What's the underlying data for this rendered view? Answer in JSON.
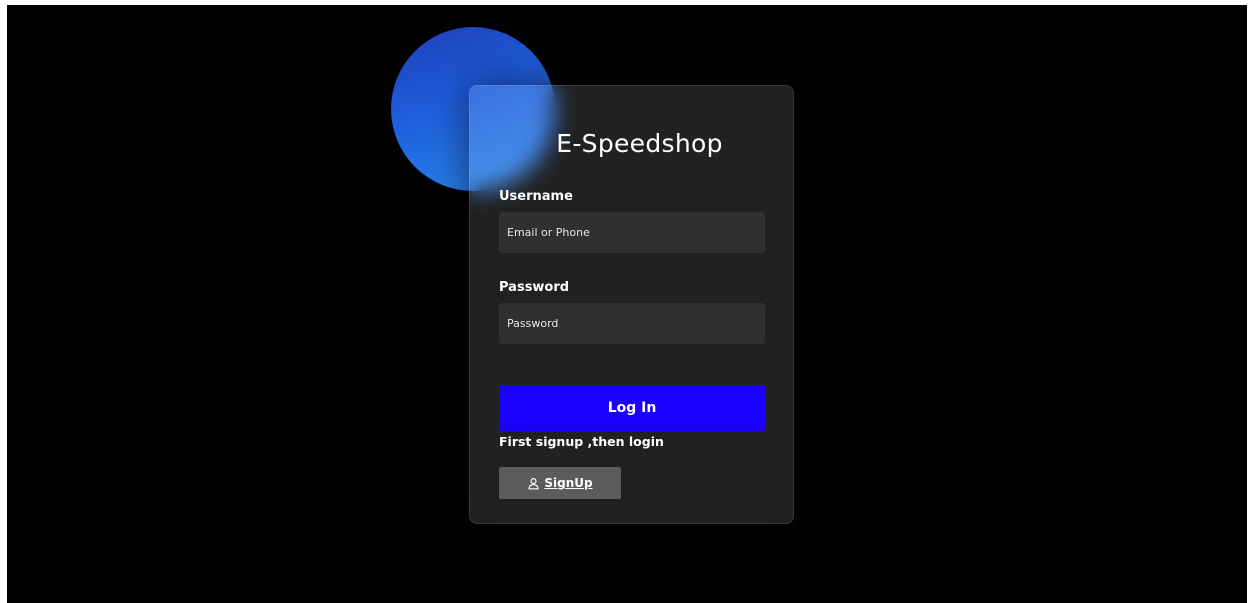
{
  "login_card": {
    "title": "E-Speedshop",
    "username_label": "Username",
    "username_placeholder": "Email or Phone",
    "password_label": "Password",
    "password_placeholder": "Password",
    "login_label": "Log In",
    "hint_text": "First signup ,then login",
    "signup_label": "SignUp",
    "signup_icon": "user-icon"
  },
  "colors": {
    "background": "#000000",
    "card": "#242424",
    "blob": "#1f5fdc",
    "login_button": "#1a00ff",
    "signup_button": "#5c5c5c",
    "text": "#ffffff"
  }
}
